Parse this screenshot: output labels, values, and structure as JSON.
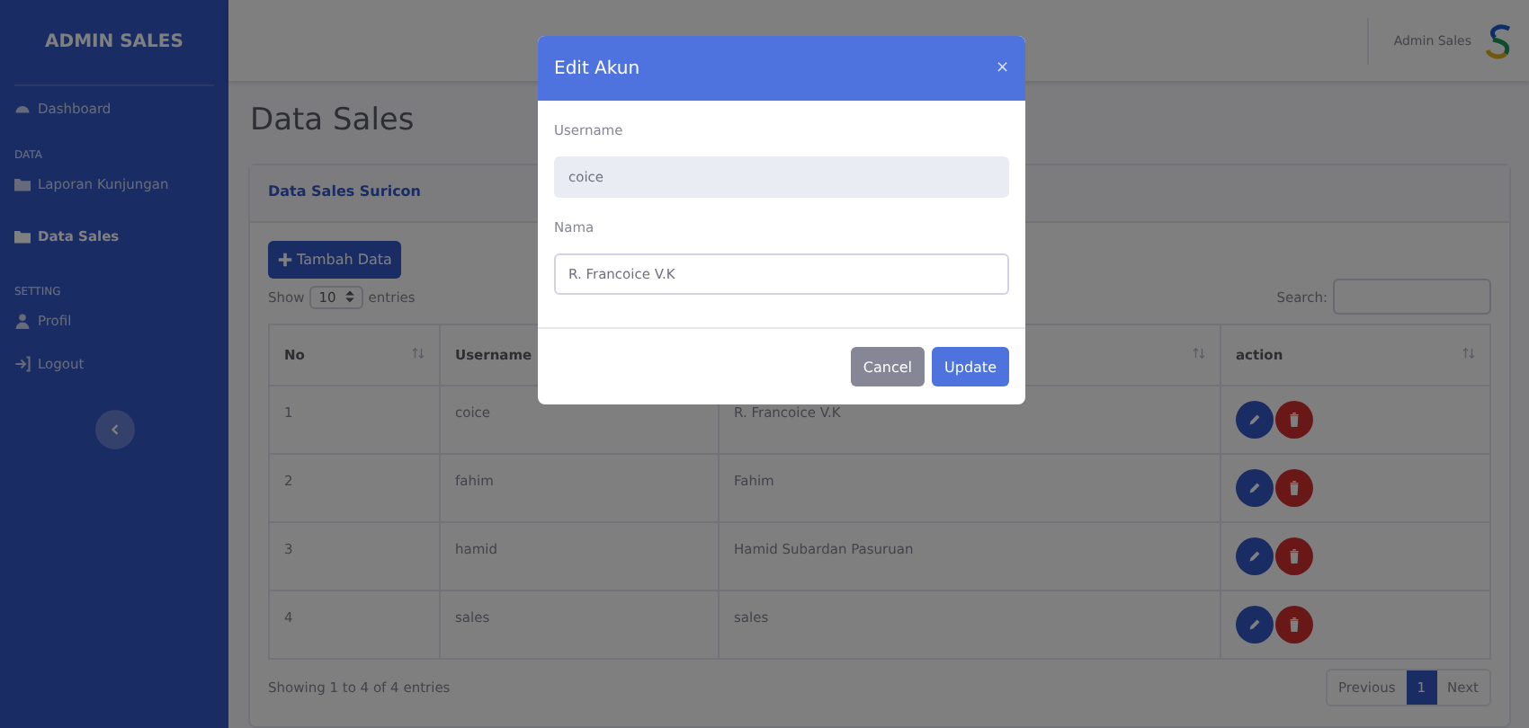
{
  "sidebar": {
    "brand": "ADMIN SALES",
    "items": [
      {
        "kind": "link",
        "label": "Dashboard",
        "selected": false
      },
      {
        "kind": "heading",
        "label": "DATA"
      },
      {
        "kind": "link",
        "label": "Laporan Kunjungan",
        "selected": false
      },
      {
        "kind": "link",
        "label": "Data Sales",
        "selected": true
      },
      {
        "kind": "heading",
        "label": "SETTING"
      },
      {
        "kind": "link",
        "label": "Profil",
        "selected": false
      },
      {
        "kind": "link",
        "label": "Logout",
        "selected": false
      }
    ]
  },
  "topbar": {
    "user_name": "Admin Sales"
  },
  "page_title": "Data Sales",
  "card": {
    "title": "Data Sales Suricon",
    "add_button": "Tambah Data",
    "length": {
      "before": "Show",
      "value": "10",
      "after": "entries"
    },
    "search_label": "Search:",
    "columns": [
      {
        "label": "No",
        "sortable": true
      },
      {
        "label": "Username"
      },
      {
        "sortable": true
      },
      {
        "label": "action",
        "sortable": true
      }
    ],
    "rows": [
      {
        "no": "1",
        "username": "coice",
        "nama": "R. Francoice V.K"
      },
      {
        "no": "2",
        "username": "fahim",
        "nama": "Fahim"
      },
      {
        "no": "3",
        "username": "hamid",
        "nama": "Hamid Subardan Pasuruan"
      },
      {
        "no": "4",
        "username": "sales",
        "nama": "sales"
      }
    ],
    "info": "Showing 1 to 4 of 4 entries",
    "pagination": [
      {
        "label": "Previous",
        "selected": false
      },
      {
        "label": "1",
        "selected": true
      },
      {
        "label": "Next",
        "selected": false
      }
    ]
  },
  "modal": {
    "title": "Edit Akun",
    "close": "×",
    "fields": [
      {
        "label": "Username",
        "value": "coice",
        "disabled": true
      },
      {
        "label": "Nama",
        "value": "R. Francoice V.K",
        "disabled": false
      }
    ],
    "buttons": [
      {
        "kind": "secondary",
        "label": "Cancel"
      },
      {
        "kind": "primary",
        "label": "Update"
      }
    ]
  }
}
